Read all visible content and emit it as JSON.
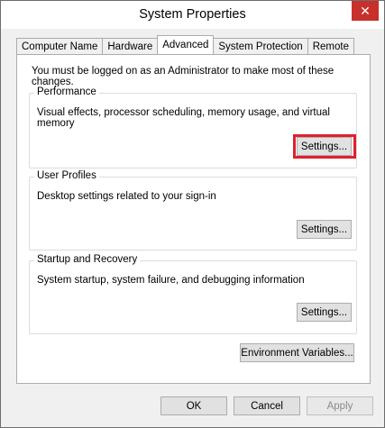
{
  "window": {
    "title": "System Properties",
    "close_glyph": "✕"
  },
  "tabs": [
    {
      "label": "Computer Name"
    },
    {
      "label": "Hardware"
    },
    {
      "label": "Advanced"
    },
    {
      "label": "System Protection"
    },
    {
      "label": "Remote"
    }
  ],
  "admin_note": "You must be logged on as an Administrator to make most of these changes.",
  "performance": {
    "label": "Performance",
    "description": "Visual effects, processor scheduling, memory usage, and virtual memory",
    "button": "Settings..."
  },
  "user_profiles": {
    "label": "User Profiles",
    "description": "Desktop settings related to your sign-in",
    "button": "Settings..."
  },
  "startup_recovery": {
    "label": "Startup and Recovery",
    "description": "System startup, system failure, and debugging information",
    "button": "Settings..."
  },
  "env_button": "Environment Variables...",
  "footer": {
    "ok": "OK",
    "cancel": "Cancel",
    "apply": "Apply"
  },
  "colors": {
    "highlight": "#e0202e",
    "close": "#c7302b"
  }
}
